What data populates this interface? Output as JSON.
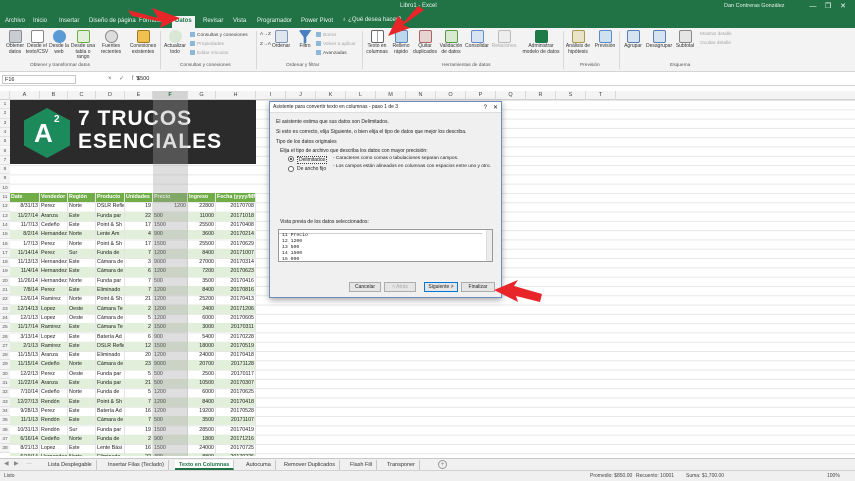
{
  "window": {
    "title": "Libro1 - Excel",
    "user": "Dan Contreras González",
    "minimize": "—",
    "restore": "❐",
    "close": "✕"
  },
  "tabs": [
    "Archivo",
    "Inicio",
    "Insertar",
    "Diseño de página",
    "Fórmulas",
    "Datos",
    "Revisar",
    "Vista",
    "Programador",
    "Power Pivot"
  ],
  "active_tab": "Datos",
  "tell_me": "¿Qué desea hacer?",
  "ribbon": {
    "obtener_datos": "Obtener datos",
    "desde_texto": "Desde el texto/CSV",
    "desde_web": "Desde la web",
    "desde_tabla": "Desde una tabla o rango",
    "fuentes_recientes": "Fuentes recientes",
    "conexiones_existentes": "Conexiones existentes",
    "actualizar_todo": "Actualizar todo",
    "consultas_conexiones": "Consultas y conexiones",
    "propiedades": "Propiedades",
    "editar_vinculos": "Editar vínculos",
    "ordenar_az": "A→Z",
    "ordenar_za": "Z→A",
    "ordenar": "Ordenar",
    "filtro": "Filtro",
    "borrar": "Borrar",
    "volver_aplicar": "Volver a aplicar",
    "avanzadas": "Avanzadas",
    "texto_columnas": "Texto en columnas",
    "relleno_rapido": "Relleno rápido",
    "quitar_duplicados": "Quitar duplicados",
    "validacion": "Validación de datos",
    "consolidar": "Consolidar",
    "relaciones": "Relaciones",
    "administrar_modelo": "Administrar modelo de datos",
    "analisis_hipotesis": "Análisis de hipótesis",
    "prevision": "Previsión",
    "agrupar": "Agrupar",
    "desagrupar": "Desagrupar",
    "subtotal": "Subtotal",
    "mostrar_detalle": "Mostrar detalle",
    "ocultar_detalle": "Ocultar detalle",
    "groups": {
      "obtener": "Obtener y transformar datos",
      "consultas": "Consultas y conexiones",
      "ordenar_filtrar": "Ordenar y filtrar",
      "herramientas": "Herramientas de datos",
      "prevision": "Previsión",
      "esquema": "Esquema"
    }
  },
  "formula_bar": {
    "name_box": "F16",
    "icons": "× ✓ fx",
    "value": "'$500"
  },
  "columns": [
    "A",
    "B",
    "C",
    "D",
    "E",
    "F",
    "G",
    "H",
    "I",
    "J",
    "K",
    "L",
    "M",
    "N",
    "O",
    "P",
    "Q",
    "R",
    "S",
    "T"
  ],
  "selected_column": "F",
  "row_numbers": [
    "1",
    "2",
    "3",
    "4",
    "5",
    "6",
    "7",
    "8",
    "9",
    "10",
    "11",
    "12",
    "13",
    "14",
    "15",
    "16",
    "17",
    "18",
    "19",
    "20",
    "21",
    "22",
    "23",
    "24",
    "25",
    "26",
    "27",
    "28",
    "29",
    "30",
    "31",
    "32",
    "33",
    "34",
    "35",
    "36",
    "37",
    "38"
  ],
  "banner": {
    "logo_letter": "A",
    "logo_sup": "2",
    "line1": "7 TRUCOS",
    "line2": "ESENCIALES"
  },
  "table": {
    "headers": [
      "Date",
      "Vendedor",
      "Región",
      "Producto",
      "Unidades",
      "Precio",
      "Ingreso",
      "Fecha (yyyy/MM/dd)"
    ],
    "rows": [
      [
        "8/31/13",
        "Perez",
        "Norte",
        "DSLR Reflex",
        "19",
        "1200",
        "22800",
        "20170708"
      ],
      [
        "11/27/14",
        "Aranza",
        "Este",
        "Funda par",
        "22",
        "500",
        "11000",
        "20171018"
      ],
      [
        "11/7/13",
        "Cedeño",
        "Este",
        "Point & Sh",
        "17",
        "1500",
        "25500",
        "20170408"
      ],
      [
        "8/2/14",
        "Hernandez",
        "Norte",
        "Lente Am",
        "4",
        "900",
        "3600",
        "20170214"
      ],
      [
        "1/7/13",
        "Perez",
        "Norte",
        "Point & Sh",
        "17",
        "1500",
        "25500",
        "20170629"
      ],
      [
        "11/14/14",
        "Perez",
        "Sur",
        "Funda de",
        "7",
        "1200",
        "8400",
        "20171007"
      ],
      [
        "11/13/13",
        "Hernandez",
        "Este",
        "Cámara de",
        "3",
        "9000",
        "27000",
        "20170314"
      ],
      [
        "11/4/14",
        "Hernandez",
        "Este",
        "Cámara de",
        "6",
        "1200",
        "7200",
        "20170623"
      ],
      [
        "11/26/14",
        "Hernandez",
        "Norte",
        "Funda par",
        "7",
        "500",
        "3500",
        "20170416"
      ],
      [
        "7/8/14",
        "Perez",
        "Este",
        "Eliminado",
        "7",
        "1200",
        "8400",
        "20170816"
      ],
      [
        "12/6/14",
        "Ramirez",
        "Norte",
        "Point & Sh",
        "21",
        "1200",
        "25200",
        "20170413"
      ],
      [
        "12/14/13",
        "Lopez",
        "Oeste",
        "Cámara Te",
        "2",
        "1200",
        "2400",
        "20171206"
      ],
      [
        "12/1/13",
        "Lopez",
        "Oeste",
        "Cámara de",
        "5",
        "1200",
        "6000",
        "20170605"
      ],
      [
        "11/17/14",
        "Ramirez",
        "Este",
        "Cámara Te",
        "2",
        "1500",
        "3000",
        "20170311"
      ],
      [
        "3/13/14",
        "Lopez",
        "Este",
        "Batería Ad",
        "6",
        "900",
        "5400",
        "20170228"
      ],
      [
        "2/1/13",
        "Ramirez",
        "Este",
        "DSLR Refle",
        "12",
        "1500",
        "18000",
        "20170519"
      ],
      [
        "11/15/13",
        "Aranza",
        "Este",
        "Eliminado",
        "20",
        "1200",
        "24000",
        "20170418"
      ],
      [
        "11/15/14",
        "Cedeño",
        "Norte",
        "Cámara de",
        "23",
        "9000",
        "20700",
        "20171128"
      ],
      [
        "12/2/13",
        "Perez",
        "Oeste",
        "Funda par",
        "5",
        "500",
        "2500",
        "20170117"
      ],
      [
        "11/22/14",
        "Aranza",
        "Este",
        "Funda par",
        "21",
        "500",
        "10500",
        "20170307"
      ],
      [
        "7/10/14",
        "Cedeño",
        "Norte",
        "Funda de",
        "5",
        "1200",
        "6000",
        "20170625"
      ],
      [
        "12/27/13",
        "Rendón",
        "Este",
        "Point & Sh",
        "7",
        "1200",
        "8400",
        "20170418"
      ],
      [
        "9/28/13",
        "Perez",
        "Este",
        "Batería Ad",
        "16",
        "1200",
        "19200",
        "20170528"
      ],
      [
        "11/1/13",
        "Rendón",
        "Este",
        "Cámara de",
        "7",
        "500",
        "3500",
        "20171107"
      ],
      [
        "10/31/13",
        "Rendón",
        "Sur",
        "Funda par",
        "19",
        "1500",
        "28500",
        "20170419"
      ],
      [
        "6/16/14",
        "Cedeño",
        "Norte",
        "Funda de",
        "2",
        "900",
        "1800",
        "20171216"
      ],
      [
        "8/21/13",
        "Lopez",
        "Este",
        "Lente Bási",
        "16",
        "1500",
        "24000",
        "20170725"
      ],
      [
        "6/19/14",
        "Hernandez",
        "Norte",
        "Eliminado",
        "22",
        "400",
        "8800",
        "20170226"
      ]
    ]
  },
  "sheet_tabs": [
    "Lista Desplegable",
    "Insertar Filas (Teclado)",
    "Texto en Columnas",
    "Autocuma",
    "Remover Duplicados",
    "Flash Fill",
    "Transponer"
  ],
  "active_sheet": "Texto en Columnas",
  "add_sheet": "+",
  "status": {
    "ready": "Listo",
    "average": "Promedio: $850.00",
    "count": "Recuento: 10001",
    "sum": "Suma: $1,700.00",
    "zoom": "100%"
  },
  "wizard": {
    "title": "Asistente para convertir texto en columnas - paso 1 de 3",
    "help": "?",
    "close": "✕",
    "intro1": "El asistente estima que sus datos son Delimitados.",
    "intro2": "Si esto es correcto, elija Siguiente, o bien elija el tipo de datos que mejor los describa.",
    "section": "Tipo de los datos originales",
    "choose": "Elija el tipo de archivo que describa los datos con mayor precisión:",
    "opt1_label": "Delimitados",
    "opt1_desc": "- Caracteres como comas o tabulaciones separan campos.",
    "opt2_label": "De ancho fijo",
    "opt2_desc": "- Los campos están alineados en columnas con espacios entre uno y otro.",
    "preview_label": "Vista previa de los datos seleccionados:",
    "preview_lines": [
      "11 Precio",
      "12 1200",
      "13 500",
      "14 1500",
      "15 900"
    ],
    "btn_cancel": "Cancelar",
    "btn_back": "< Atrás",
    "btn_next": "Siguiente >",
    "btn_finish": "Finalizar"
  },
  "colors": {
    "excel_green": "#217346",
    "header_green": "#70ad47",
    "arrow_red": "#e8262a"
  }
}
